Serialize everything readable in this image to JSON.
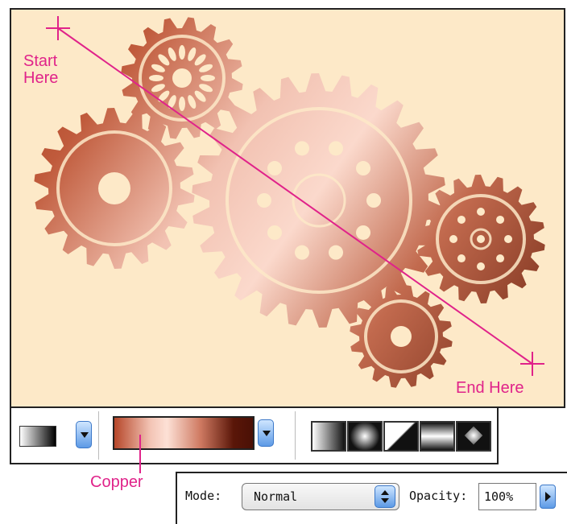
{
  "annotations": {
    "start_line1": "Start",
    "start_line2": "Here",
    "end": "End Here",
    "copper": "Copper"
  },
  "toolbar": {
    "gradient_picker": "gradient-picker",
    "selected_gradient": "Copper",
    "styles": [
      "linear-gradient-icon",
      "radial-gradient-icon",
      "angle-gradient-icon",
      "reflected-gradient-icon",
      "diamond-gradient-icon"
    ]
  },
  "options": {
    "mode_label": "Mode:",
    "mode_value": "Normal",
    "opacity_label": "Opacity:",
    "opacity_value": "100%"
  },
  "colors": {
    "background": "#fde9c8",
    "copper_dark": "#8a2d12",
    "copper_light": "#f4c7b6",
    "annotation": "#e0238a"
  }
}
